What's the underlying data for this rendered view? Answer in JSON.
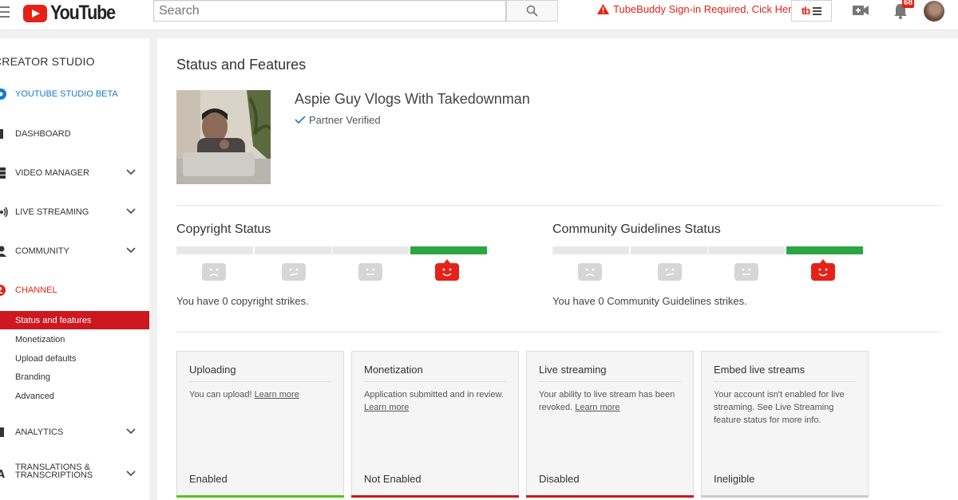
{
  "header": {
    "logo_text": "YouTube",
    "search_placeholder": "Search",
    "tubebuddy_warning": "TubeBuddy Sign-in Required, Cick Here",
    "tubebuddy_label": "tb",
    "notifications_count": "68"
  },
  "sidebar": {
    "studio_title": "CREATOR STUDIO",
    "items": [
      {
        "label": "YOUTUBE STUDIO BETA"
      },
      {
        "label": "DASHBOARD"
      },
      {
        "label": "VIDEO MANAGER"
      },
      {
        "label": "LIVE STREAMING"
      },
      {
        "label": "COMMUNITY"
      },
      {
        "label": "CHANNEL"
      },
      {
        "label": "ANALYTICS"
      },
      {
        "label": "TRANSLATIONS &\nTRANSCRIPTIONS"
      }
    ],
    "channel_sub": [
      {
        "label": "Status and features"
      },
      {
        "label": "Monetization"
      },
      {
        "label": "Upload defaults"
      },
      {
        "label": "Branding"
      },
      {
        "label": "Advanced"
      }
    ]
  },
  "main": {
    "title": "Status and Features",
    "channel_name": "Aspie Guy Vlogs With Takedownman",
    "partner_status": "Partner Verified",
    "copyright": {
      "title": "Copyright Status",
      "text": "You have 0 copyright strikes.",
      "strikes": 0
    },
    "community": {
      "title": "Community Guidelines Status",
      "text": "You have 0 Community Guidelines strikes.",
      "strikes": 0
    },
    "cards": [
      {
        "title": "Uploading",
        "desc": "You can upload!",
        "link": "Learn more",
        "state": "Enabled",
        "color": "#50c41b"
      },
      {
        "title": "Monetization",
        "desc": "Application submitted and in review.",
        "link": "Learn more",
        "state": "Not Enabled",
        "color": "#cc181e"
      },
      {
        "title": "Live streaming",
        "desc": "Your ability to live stream has been revoked.",
        "link": "Learn more",
        "state": "Disabled",
        "color": "#cc181e"
      },
      {
        "title": "Embed live streams",
        "desc": "Your account isn't enabled for live streaming. See Live Streaming feature status for more info.",
        "link": "",
        "state": "Ineligible",
        "color": "#cccccc"
      }
    ]
  },
  "colors": {
    "brand_red": "#e62117",
    "link_blue": "#167ac6",
    "status_green": "#2ba640"
  }
}
